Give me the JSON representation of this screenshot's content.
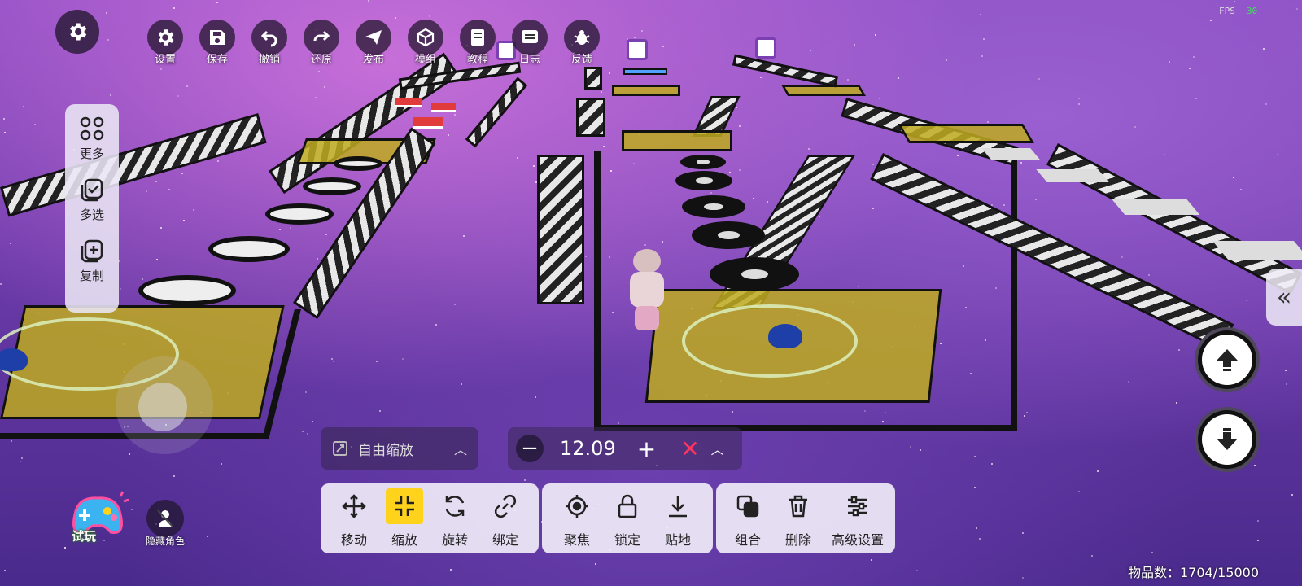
{
  "top_toolbar": {
    "items": [
      {
        "label": "设置",
        "icon": "gear-icon"
      },
      {
        "label": "保存",
        "icon": "save-icon"
      },
      {
        "label": "撤销",
        "icon": "undo-icon"
      },
      {
        "label": "还原",
        "icon": "redo-icon"
      },
      {
        "label": "发布",
        "icon": "publish-icon"
      },
      {
        "label": "模组",
        "icon": "cube-icon"
      },
      {
        "label": "教程",
        "icon": "book-icon"
      },
      {
        "label": "日志",
        "icon": "log-icon"
      },
      {
        "label": "反馈",
        "icon": "bug-icon"
      }
    ]
  },
  "fps": {
    "label": "FPS",
    "value": "30"
  },
  "left_panel": {
    "more": "更多",
    "multi_select": "多选",
    "copy": "复制"
  },
  "scale": {
    "mode_label": "自由缩放",
    "value": "12.09",
    "minus": "−",
    "plus": "+",
    "x_mark": "✕"
  },
  "bottom_toolbar": {
    "group1": [
      {
        "label": "移动",
        "icon": "move-icon",
        "active": false
      },
      {
        "label": "缩放",
        "icon": "scale-icon",
        "active": true
      },
      {
        "label": "旋转",
        "icon": "rotate-icon",
        "active": false
      },
      {
        "label": "绑定",
        "icon": "link-icon",
        "active": false
      }
    ],
    "group2": [
      {
        "label": "聚焦",
        "icon": "focus-icon"
      },
      {
        "label": "锁定",
        "icon": "lock-icon"
      },
      {
        "label": "贴地",
        "icon": "ground-icon"
      }
    ],
    "group3": [
      {
        "label": "组合",
        "icon": "combine-icon"
      },
      {
        "label": "删除",
        "icon": "trash-icon"
      },
      {
        "label": "高级设置",
        "icon": "sliders-icon"
      }
    ]
  },
  "try_play": {
    "label": "试玩"
  },
  "hide_role": {
    "label": "隐藏角色"
  },
  "item_count": {
    "text": "物品数：1704/15000"
  },
  "colors": {
    "active_tool": "#ffd21c",
    "fps_value": "#3fe05a",
    "x_mark": "#ff3560",
    "pad": "#beaa1e"
  }
}
